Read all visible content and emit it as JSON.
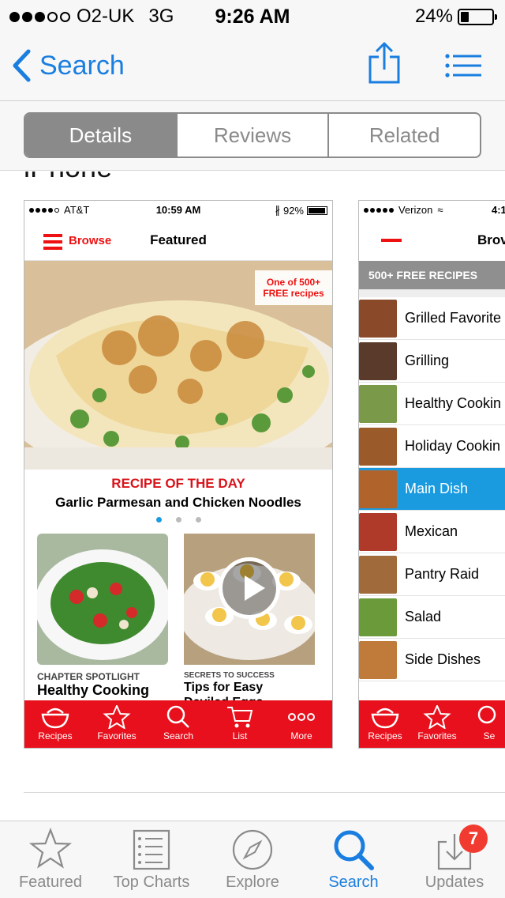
{
  "status_bar": {
    "carrier": "O2-UK",
    "network": "3G",
    "time": "9:26 AM",
    "battery": "24%",
    "battery_level": 0.24
  },
  "nav": {
    "back_label": "Search"
  },
  "segments": [
    {
      "label": "Details",
      "active": true
    },
    {
      "label": "Reviews",
      "active": false
    },
    {
      "label": "Related",
      "active": false
    }
  ],
  "section": {
    "heading": "iPhone"
  },
  "screenshot1": {
    "status": {
      "carrier": "AT&T",
      "time": "10:59 AM",
      "battery": "92%"
    },
    "browse": "Browse",
    "title": "Featured",
    "badge_line1": "One of 500+",
    "badge_line2": "FREE recipes",
    "recipe_of_day": "RECIPE OF THE DAY",
    "recipe_title": "Garlic Parmesan and Chicken Noodles",
    "tile1_kicker": "CHAPTER SPOTLIGHT",
    "tile1_title": "Healthy Cooking",
    "tile2_kicker": "SECRETS TO SUCCESS",
    "tile2_title_line1": "Tips for Easy",
    "tile2_title_line2": "Deviled Eggs",
    "tabs": [
      "Recipes",
      "Favorites",
      "Search",
      "List",
      "More"
    ]
  },
  "screenshot2": {
    "status": {
      "carrier": "Verizon",
      "time": "4:1"
    },
    "title": "Brov",
    "banner": "500+ FREE RECIPES",
    "categories": [
      {
        "label": "Grilled Favorite",
        "color": "#8a4a2a"
      },
      {
        "label": "Grilling",
        "color": "#5a3a2a"
      },
      {
        "label": "Healthy Cookin",
        "color": "#7a9a4a"
      },
      {
        "label": "Holiday Cookin",
        "color": "#9a5a2a"
      },
      {
        "label": "Main Dish",
        "color": "#b0642c",
        "selected": true
      },
      {
        "label": "Mexican",
        "color": "#b03a2a"
      },
      {
        "label": "Pantry Raid",
        "color": "#a06a3a"
      },
      {
        "label": "Salad",
        "color": "#6a9a3a"
      },
      {
        "label": "Side Dishes",
        "color": "#c07a3a"
      }
    ],
    "tabs": [
      "Recipes",
      "Favorites",
      "Se"
    ]
  },
  "tabbar": {
    "items": [
      {
        "label": "Featured",
        "icon": "star-icon"
      },
      {
        "label": "Top Charts",
        "icon": "list-icon"
      },
      {
        "label": "Explore",
        "icon": "compass-icon"
      },
      {
        "label": "Search",
        "icon": "search-icon",
        "active": true
      },
      {
        "label": "Updates",
        "icon": "download-icon",
        "badge": "7"
      }
    ]
  }
}
